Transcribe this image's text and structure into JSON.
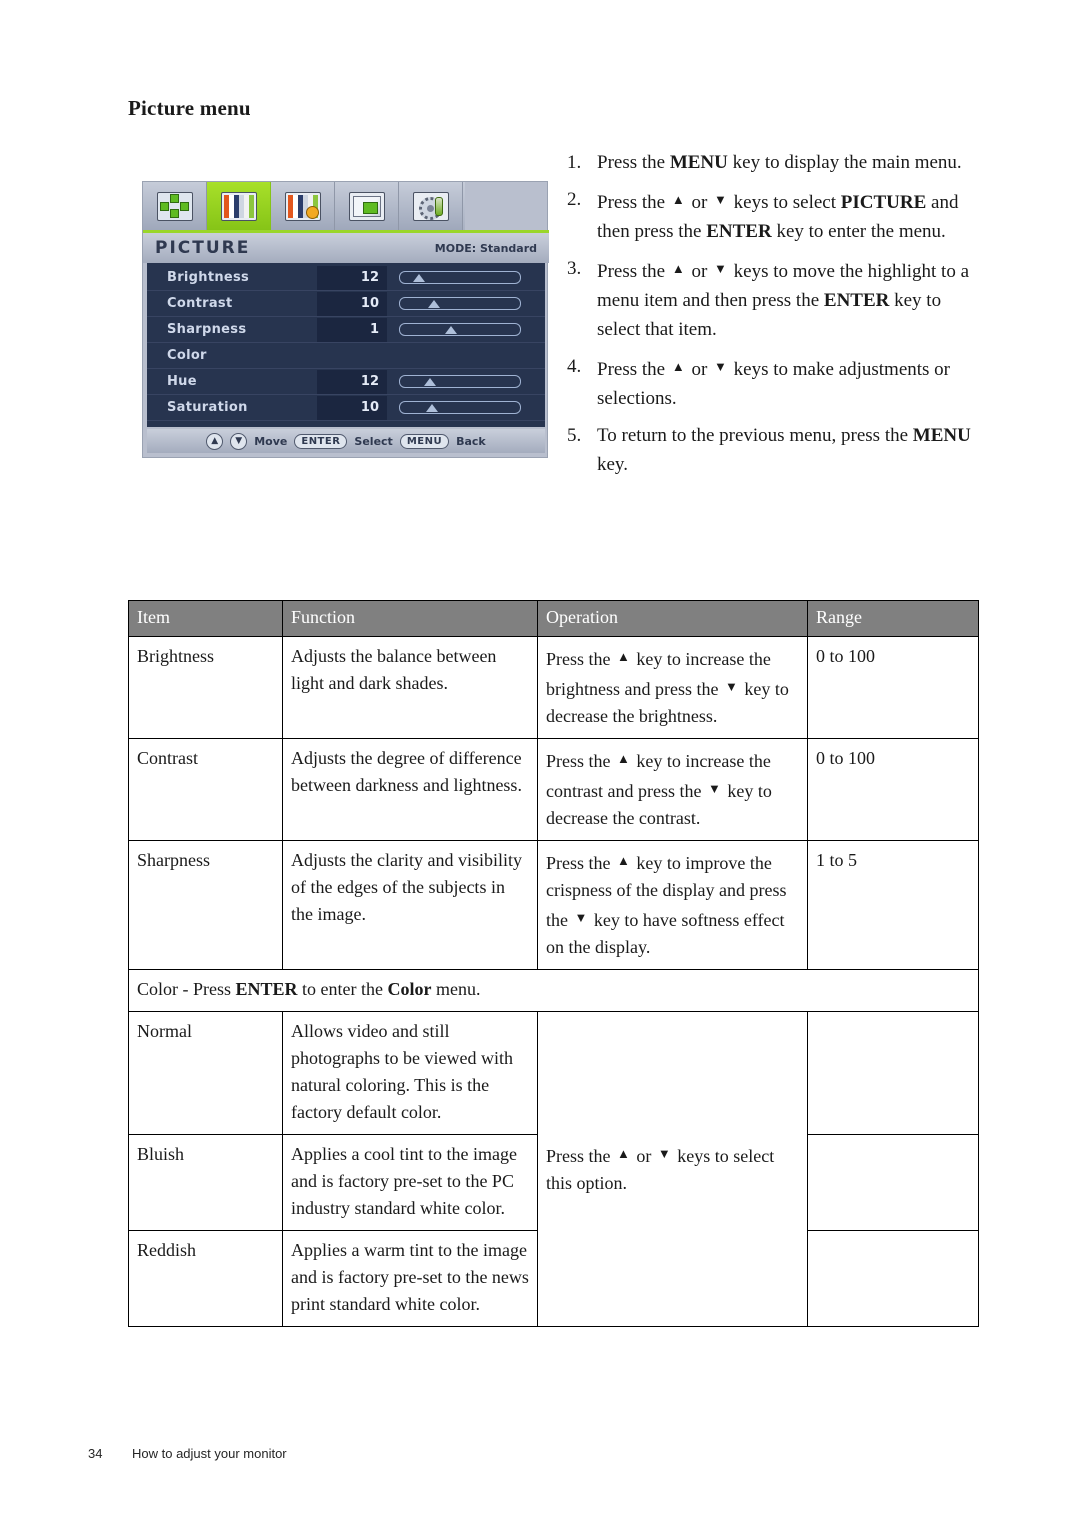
{
  "heading": "Picture menu",
  "osd": {
    "title": "PICTURE",
    "mode": "MODE: Standard",
    "tabs": [
      {
        "name": "display-tab",
        "icon": "position-arrows-icon",
        "selected": false
      },
      {
        "name": "picture-tab",
        "icon": "color-bars-icon",
        "selected": true
      },
      {
        "name": "picture-advanced-tab",
        "icon": "color-bars-plus-icon",
        "selected": false
      },
      {
        "name": "audio-tab",
        "icon": "screen-in-screen-icon",
        "selected": false
      },
      {
        "name": "system-tab",
        "icon": "gear-tool-icon",
        "selected": false
      }
    ],
    "rows": [
      {
        "label": "Brightness",
        "value": "12",
        "pct": 12,
        "slider": true
      },
      {
        "label": "Contrast",
        "value": "10",
        "pct": 26,
        "slider": true
      },
      {
        "label": "Sharpness",
        "value": "1",
        "pct": 42,
        "slider": true
      },
      {
        "label": "Color",
        "value": "",
        "pct": 0,
        "slider": false
      },
      {
        "label": "Hue",
        "value": "12",
        "pct": 22,
        "slider": true
      },
      {
        "label": "Saturation",
        "value": "10",
        "pct": 24,
        "slider": true
      }
    ],
    "statusbar": {
      "up_key": "▲",
      "down_key": "▼",
      "move_label": "Move",
      "enter_key": "ENTER",
      "select_label": "Select",
      "menu_key": "MENU",
      "back_label": "Back"
    }
  },
  "steps": [
    {
      "num": "1.",
      "parts": [
        {
          "t": "Press the ",
          "s": "n"
        },
        {
          "t": "MENU",
          "s": "b"
        },
        {
          "t": " key to display the main menu.",
          "s": "n"
        }
      ]
    },
    {
      "num": "2.",
      "parts": [
        {
          "t": "Press the ",
          "s": "n"
        },
        {
          "t": "▲",
          "s": "tri"
        },
        {
          "t": " or ",
          "s": "n"
        },
        {
          "t": "▼",
          "s": "tri"
        },
        {
          "t": " keys to select ",
          "s": "n"
        },
        {
          "t": "PICTURE",
          "s": "b"
        },
        {
          "t": " and then press the ",
          "s": "n"
        },
        {
          "t": "ENTER",
          "s": "b"
        },
        {
          "t": " key to enter the menu.",
          "s": "n"
        }
      ]
    },
    {
      "num": "3.",
      "parts": [
        {
          "t": "Press the ",
          "s": "n"
        },
        {
          "t": "▲",
          "s": "tri"
        },
        {
          "t": " or ",
          "s": "n"
        },
        {
          "t": "▼",
          "s": "tri"
        },
        {
          "t": " keys to move the highlight to a menu item and then press the ",
          "s": "n"
        },
        {
          "t": "ENTER",
          "s": "b"
        },
        {
          "t": " key to select that item.",
          "s": "n"
        }
      ]
    },
    {
      "num": "4.",
      "parts": [
        {
          "t": "Press the ",
          "s": "n"
        },
        {
          "t": "▲",
          "s": "tri"
        },
        {
          "t": " or ",
          "s": "n"
        },
        {
          "t": "▼",
          "s": "tri"
        },
        {
          "t": " keys to make adjustments or selections.",
          "s": "n"
        }
      ]
    },
    {
      "num": "5.",
      "parts": [
        {
          "t": "To return to the previous menu, press the ",
          "s": "n"
        },
        {
          "t": "MENU",
          "s": "b"
        },
        {
          "t": " key.",
          "s": "n"
        }
      ]
    }
  ],
  "table": {
    "headers": [
      "Item",
      "Function",
      "Operation",
      "Range"
    ],
    "rows": [
      {
        "kind": "data",
        "item": "Brightness",
        "function": "Adjusts the balance between light and dark shades.",
        "operation": [
          {
            "t": "Press the ",
            "s": "n"
          },
          {
            "t": "▲",
            "s": "tri"
          },
          {
            "t": " key to increase the brightness and press the ",
            "s": "n"
          },
          {
            "t": "▼",
            "s": "tri"
          },
          {
            "t": " key to decrease the brightness.",
            "s": "n"
          }
        ],
        "range": "0 to 100"
      },
      {
        "kind": "data",
        "item": "Contrast",
        "function": "Adjusts the degree of difference between darkness and lightness.",
        "operation": [
          {
            "t": "Press the ",
            "s": "n"
          },
          {
            "t": "▲",
            "s": "tri"
          },
          {
            "t": " key to increase the contrast and press the ",
            "s": "n"
          },
          {
            "t": "▼",
            "s": "tri"
          },
          {
            "t": " key to decrease the contrast.",
            "s": "n"
          }
        ],
        "range": "0 to 100"
      },
      {
        "kind": "data",
        "item": "Sharpness",
        "function": "Adjusts the clarity and visibility of the edges of the subjects in the image.",
        "operation": [
          {
            "t": "Press the ",
            "s": "n"
          },
          {
            "t": "▲",
            "s": "tri"
          },
          {
            "t": " key to improve the crispness of the display and press the ",
            "s": "n"
          },
          {
            "t": "▼",
            "s": "tri"
          },
          {
            "t": " key to have softness effect on the display.",
            "s": "n"
          }
        ],
        "range": "1 to 5"
      },
      {
        "kind": "section",
        "text": [
          {
            "t": "Color - Press ",
            "s": "n"
          },
          {
            "t": "ENTER",
            "s": "b"
          },
          {
            "t": " to enter the ",
            "s": "n"
          },
          {
            "t": "Color",
            "s": "b"
          },
          {
            "t": " menu.",
            "s": "n"
          }
        ]
      },
      {
        "kind": "data",
        "item": "Normal",
        "function": "Allows video and still photographs to be viewed with natural coloring. This is the factory default color.",
        "operation": [],
        "range": "",
        "operation_rowspan": 3
      },
      {
        "kind": "data",
        "item": "Bluish",
        "function": "Applies a cool tint to the image and is factory pre-set to the PC industry standard white color.",
        "operation": [
          {
            "t": "Press the ",
            "s": "n"
          },
          {
            "t": "▲",
            "s": "tri"
          },
          {
            "t": " or ",
            "s": "n"
          },
          {
            "t": "▼",
            "s": "tri"
          },
          {
            "t": " keys to select this option.",
            "s": "n"
          }
        ],
        "range": "",
        "operation_merged": true
      },
      {
        "kind": "data",
        "item": "Reddish",
        "function": "Applies a warm tint to the image and is factory pre-set to the news print standard white color.",
        "operation": [],
        "range": "",
        "operation_merged": true
      }
    ]
  },
  "footer": {
    "page_number": "34",
    "section_title": "How to adjust your monitor"
  }
}
